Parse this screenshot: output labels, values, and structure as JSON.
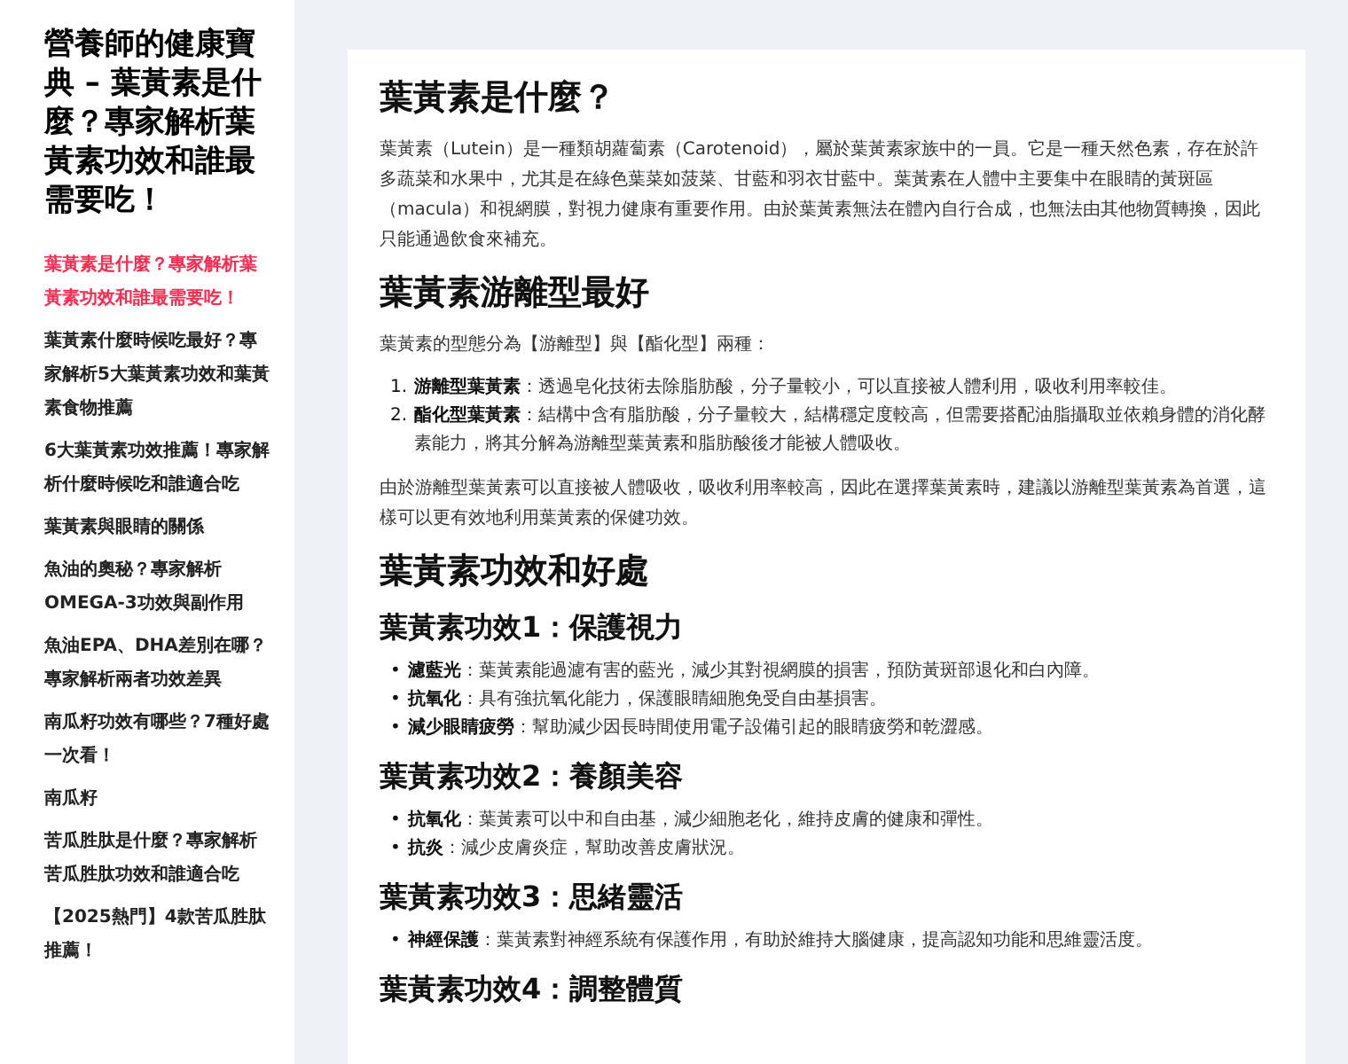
{
  "sidebar": {
    "title": "營養師的健康寶典 – 葉黃素是什麼？專家解析葉黃素功效和誰最需要吃！",
    "items": [
      {
        "label": "葉黃素是什麼？專家解析葉黃素功效和誰最需要吃！",
        "selected": true
      },
      {
        "label": "葉黃素什麼時候吃最好？專家解析5大葉黃素功效和葉黃素食物推薦",
        "selected": false
      },
      {
        "label": "6大葉黃素功效推薦！專家解析什麼時候吃和誰適合吃",
        "selected": false
      },
      {
        "label": "葉黃素與眼睛的關係",
        "selected": false
      },
      {
        "label": "魚油的奧秘？專家解析OMEGA-3功效與副作用",
        "selected": false
      },
      {
        "label": "魚油EPA、DHA差別在哪？專家解析兩者功效差異",
        "selected": false
      },
      {
        "label": "南瓜籽功效有哪些？7種好處一次看！",
        "selected": false
      },
      {
        "label": "南瓜籽",
        "selected": false
      },
      {
        "label": "苦瓜胜肽是什麼？專家解析苦瓜胜肽功效和誰適合吃",
        "selected": false
      },
      {
        "label": "【2025熱門】4款苦瓜胜肽推薦！",
        "selected": false
      }
    ]
  },
  "article": {
    "blocks": [
      {
        "kind": "h2",
        "text": "葉黃素是什麼？"
      },
      {
        "kind": "p",
        "text": "葉黃素（Lutein）是一種類胡蘿蔔素（Carotenoid），屬於葉黃素家族中的一員。它是一種天然色素，存在於許多蔬菜和水果中，尤其是在綠色葉菜如菠菜、甘藍和羽衣甘藍中。葉黃素在人體中主要集中在眼睛的黃斑區（macula）和視網膜，對視力健康有重要作用。由於葉黃素無法在體內自行合成，也無法由其他物質轉換，因此只能通過飲食來補充。"
      },
      {
        "kind": "h2",
        "text": "葉黃素游離型最好"
      },
      {
        "kind": "p",
        "text": "葉黃素的型態分為【游離型】與【酯化型】兩種："
      },
      {
        "kind": "ol",
        "items": [
          {
            "marker": "1.",
            "term": "游離型葉黃素",
            "text": "：透過皂化技術去除脂肪酸，分子量較小，可以直接被人體利用，吸收利用率較佳。"
          },
          {
            "marker": "2.",
            "term": "酯化型葉黃素",
            "text": "：結構中含有脂肪酸，分子量較大，結構穩定度較高，但需要搭配油脂攝取並依賴身體的消化酵素能力，將其分解為游離型葉黃素和脂肪酸後才能被人體吸收。"
          }
        ]
      },
      {
        "kind": "p",
        "text": "由於游離型葉黃素可以直接被人體吸收，吸收利用率較高，因此在選擇葉黃素時，建議以游離型葉黃素為首選，這樣可以更有效地利用葉黃素的保健功效。"
      },
      {
        "kind": "h2",
        "text": "葉黃素功效和好處"
      },
      {
        "kind": "h3",
        "text": "葉黃素功效1：保護視力"
      },
      {
        "kind": "ul",
        "items": [
          {
            "marker": "•",
            "term": "濾藍光",
            "text": "：葉黃素能過濾有害的藍光，減少其對視網膜的損害，預防黃斑部退化和白內障。"
          },
          {
            "marker": "•",
            "term": "抗氧化",
            "text": "：具有強抗氧化能力，保護眼睛細胞免受自由基損害。"
          },
          {
            "marker": "•",
            "term": "減少眼睛疲勞",
            "text": "：幫助減少因長時間使用電子設備引起的眼睛疲勞和乾澀感。"
          }
        ]
      },
      {
        "kind": "h3",
        "text": "葉黃素功效2：養顏美容"
      },
      {
        "kind": "ul",
        "items": [
          {
            "marker": "•",
            "term": "抗氧化",
            "text": "：葉黃素可以中和自由基，減少細胞老化，維持皮膚的健康和彈性。"
          },
          {
            "marker": "•",
            "term": "抗炎",
            "text": "：減少皮膚炎症，幫助改善皮膚狀況。"
          }
        ]
      },
      {
        "kind": "h3",
        "text": "葉黃素功效3：思緒靈活"
      },
      {
        "kind": "ul",
        "items": [
          {
            "marker": "•",
            "term": "神經保護",
            "text": "：葉黃素對神經系統有保護作用，有助於維持大腦健康，提高認知功能和思維靈活度。"
          }
        ]
      },
      {
        "kind": "h3",
        "text": "葉黃素功效4：調整體質"
      }
    ]
  }
}
